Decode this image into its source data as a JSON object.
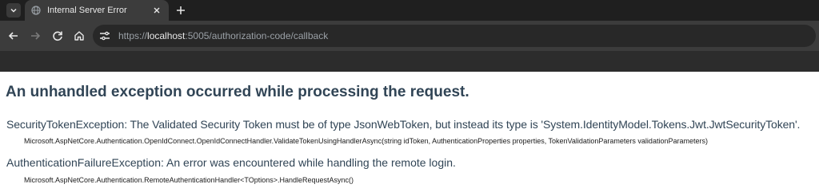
{
  "browser": {
    "tab": {
      "title": "Internal Server Error"
    },
    "address": {
      "scheme": "https://",
      "host": "localhost",
      "rest": ":5005/authorization-code/callback"
    },
    "icons": {
      "tab_list": "chevron-down-icon",
      "favicon": "globe-icon",
      "tab_close": "close-icon",
      "new_tab": "plus-icon",
      "back": "back-arrow-icon",
      "forward": "forward-arrow-icon",
      "reload": "reload-icon",
      "home": "home-icon",
      "site_info": "tune-icon"
    }
  },
  "page": {
    "heading": "An unhandled exception occurred while processing the request.",
    "exceptions": [
      {
        "message": "SecurityTokenException: The Validated Security Token must be of type JsonWebToken, but instead its type is 'System.IdentityModel.Tokens.Jwt.JwtSecurityToken'.",
        "location": "Microsoft.AspNetCore.Authentication.OpenIdConnect.OpenIdConnectHandler.ValidateTokenUsingHandlerAsync(string idToken, AuthenticationProperties properties, TokenValidationParameters validationParameters)"
      },
      {
        "message": "AuthenticationFailureException: An error was encountered while handling the remote login.",
        "location": "Microsoft.AspNetCore.Authentication.RemoteAuthenticationHandler<TOptions>.HandleRequestAsync()"
      }
    ]
  },
  "colors": {
    "heading": "#314556",
    "chrome_dark": "#1f1f1f",
    "toolbar": "#3c3c3c"
  }
}
